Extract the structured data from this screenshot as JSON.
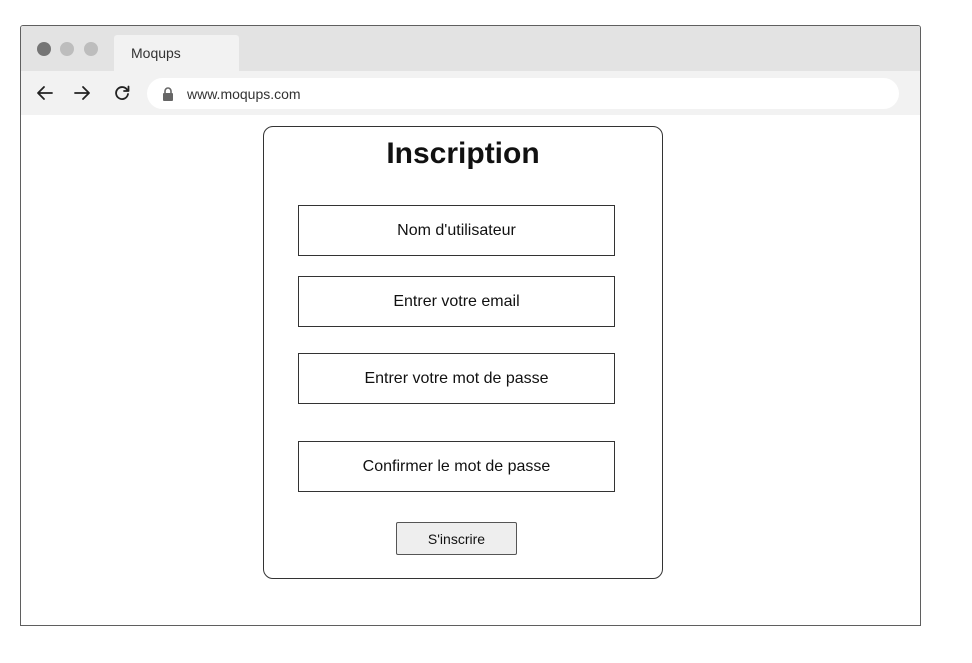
{
  "browser": {
    "tab_title": "Moqups",
    "url": "www.moqups.com",
    "icons": {
      "back": "arrow-left-icon",
      "forward": "arrow-right-icon",
      "reload": "reload-icon",
      "lock": "lock-icon"
    }
  },
  "form": {
    "title": "Inscription",
    "fields": [
      {
        "placeholder": "Nom d'utilisateur"
      },
      {
        "placeholder": "Entrer votre email"
      },
      {
        "placeholder": "Entrer votre mot de passe"
      },
      {
        "placeholder": "Confirmer le mot de passe"
      }
    ],
    "submit_label": "S'inscrire"
  },
  "colors": {
    "frame_border": "#5f5f5f",
    "tabbar_bg": "#e3e3e3",
    "navbar_bg": "#f2f2f2",
    "button_bg": "#eeeeee"
  }
}
